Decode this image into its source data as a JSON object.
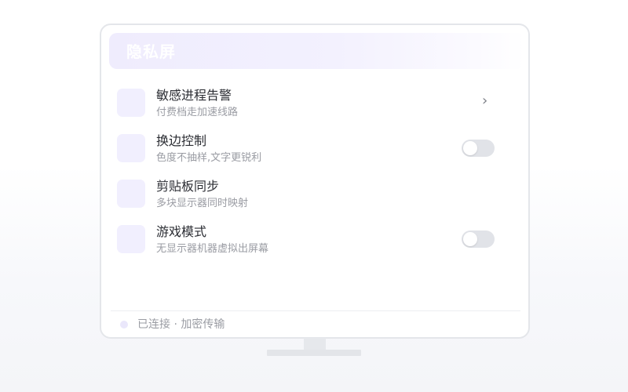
{
  "header": {
    "title": "隐私屏"
  },
  "settings": [
    {
      "title": "敏感进程告警",
      "subtitle": "付费档走加速线路",
      "control": "chevron",
      "chevron_glyph": "›",
      "icon": "feature-icon"
    },
    {
      "title": "换边控制",
      "subtitle": "色度不抽样,文字更锐利",
      "control": "toggle",
      "toggle_on": false,
      "icon": "feature-icon"
    },
    {
      "title": "剪贴板同步",
      "subtitle": "多块显示器同时映射",
      "control": "none",
      "icon": "feature-icon"
    },
    {
      "title": "游戏模式",
      "subtitle": "无显示器机器虚拟出屏幕",
      "control": "toggle",
      "toggle_on": false,
      "icon": "feature-icon"
    }
  ],
  "footer": {
    "status_text": "已连接 · 加密传输",
    "status_dot_color": "#eae7fb"
  },
  "colors": {
    "accent_light": "#f1effe",
    "toggle_off": "#e1e3e8"
  }
}
